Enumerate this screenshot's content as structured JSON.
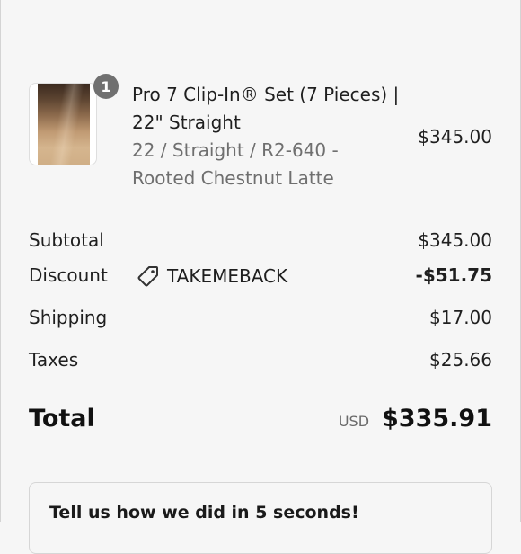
{
  "product": {
    "quantity_badge": "1",
    "title": "Pro 7 Clip-In® Set (7 Pieces) | 22\" Straight",
    "variant": "22 / Straight / R2-640 - Rooted Chestnut Latte",
    "price": "$345.00"
  },
  "summary": {
    "subtotal_label": "Subtotal",
    "subtotal_value": "$345.00",
    "discount_label": "Discount",
    "discount_code": "TAKEMEBACK",
    "discount_value": "-$51.75",
    "shipping_label": "Shipping",
    "shipping_value": "$17.00",
    "taxes_label": "Taxes",
    "taxes_value": "$25.66",
    "total_label": "Total",
    "currency": "USD",
    "total_value": "$335.91"
  },
  "feedback": {
    "title": "Tell us how we did in 5 seconds!"
  },
  "icons": {
    "discount": "tag-icon"
  }
}
